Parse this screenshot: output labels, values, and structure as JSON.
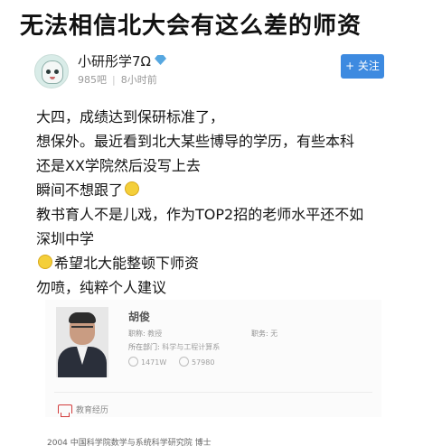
{
  "post": {
    "title": "无法相信北大会有这么差的师资"
  },
  "author": {
    "name": "小研彤学7Ω",
    "followers": "985吧",
    "time": "8小时前",
    "follow_label": "+ 关注"
  },
  "body": {
    "lines": [
      "大四，成绩达到保研标准了，",
      "想保外。最近看到北大某些博导的学历，有些本科",
      "还是XX学院然后没写上去",
      "瞬间不想跟了",
      "教书育人不是儿戏，作为TOP2招的老师水平还不如",
      "深圳中学",
      "希望北大能整顿下师资",
      "勿喷，纯粹个人建议"
    ]
  },
  "profile_card": {
    "name": "胡俊",
    "title_label": "职称:",
    "title_value": "教授",
    "position_label": "职务:",
    "position_value": "无",
    "dept_label": "所在部门:",
    "dept_value": "科学与工程计算系",
    "views": "1471W",
    "likes": "57980",
    "education_label": "教育经历"
  },
  "footer_text": "2004 中国科学院数学与系统科学研究院 博士"
}
